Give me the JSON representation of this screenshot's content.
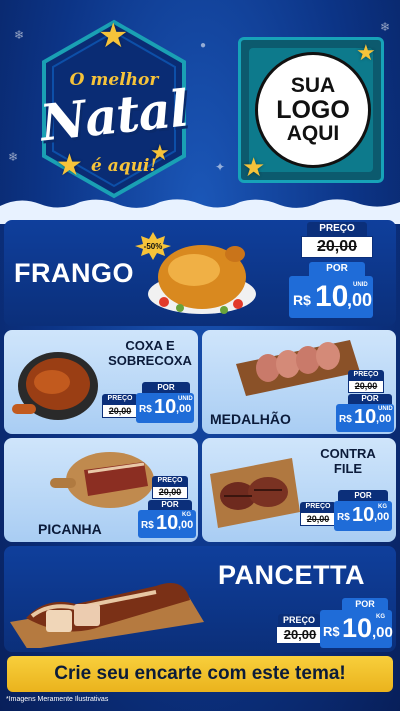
{
  "header": {
    "badge": {
      "line1": "O melhor",
      "line2": "Natal",
      "line3": "é aqui!"
    },
    "logo": {
      "line1": "SUA",
      "line2": "LOGO",
      "line3": "AQUI"
    }
  },
  "colors": {
    "navy": "#0b2f7a",
    "gold": "#f6c33a",
    "price_blue": "#1f6cd8",
    "teal": "#0d7a8c"
  },
  "products": {
    "frango": {
      "name": "FRANGO",
      "discount": "-50%",
      "price_label": "PREÇO",
      "old_price": "20,00",
      "now_label": "POR",
      "currency": "R$",
      "int": "10",
      "dec": ",00",
      "unit": "UNID"
    },
    "coxa": {
      "name_line1": "COXA E",
      "name_line2": "SOBRECOXA",
      "price_label": "PREÇO",
      "old_price": "20,00",
      "now_label": "POR",
      "currency": "R$",
      "int": "10",
      "dec": ",00",
      "unit": "UNID"
    },
    "medalhao": {
      "name": "MEDALHÃO",
      "price_label": "PREÇO",
      "old_price": "20,00",
      "now_label": "POR",
      "currency": "R$",
      "int": "10",
      "dec": ",00",
      "unit": "UNID"
    },
    "picanha": {
      "name": "PICANHA",
      "price_label": "PREÇO",
      "old_price": "20,00",
      "now_label": "POR",
      "currency": "R$",
      "int": "10",
      "dec": ",00",
      "unit": "KG"
    },
    "contrafile": {
      "name_line1": "CONTRA",
      "name_line2": "FILE",
      "price_label": "PREÇO",
      "old_price": "20,00",
      "now_label": "POR",
      "currency": "R$",
      "int": "10",
      "dec": ",00",
      "unit": "KG"
    },
    "pancetta": {
      "name": "PANCETTA",
      "price_label": "PREÇO",
      "old_price": "20,00",
      "now_label": "POR",
      "currency": "R$",
      "int": "10",
      "dec": ",00",
      "unit": "KG"
    }
  },
  "footer": {
    "cta": "Crie seu encarte com este tema!",
    "note": "*Imagens Meramente Ilustrativas"
  }
}
